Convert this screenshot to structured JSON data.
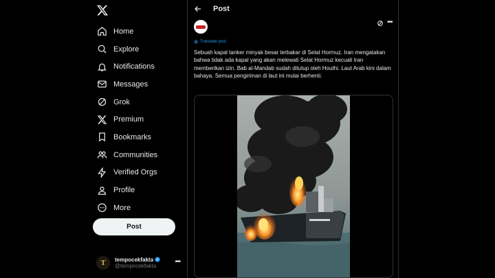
{
  "sidebar": {
    "logo_icon": "x-logo-icon",
    "items": [
      {
        "label": "Home",
        "icon": "home-icon"
      },
      {
        "label": "Explore",
        "icon": "search-icon"
      },
      {
        "label": "Notifications",
        "icon": "bell-icon"
      },
      {
        "label": "Messages",
        "icon": "mail-icon"
      },
      {
        "label": "Grok",
        "icon": "grok-icon"
      },
      {
        "label": "Premium",
        "icon": "x-premium-icon"
      },
      {
        "label": "Bookmarks",
        "icon": "bookmark-icon"
      },
      {
        "label": "Communities",
        "icon": "people-icon"
      },
      {
        "label": "Verified Orgs",
        "icon": "lightning-icon"
      },
      {
        "label": "Profile",
        "icon": "person-icon"
      },
      {
        "label": "More",
        "icon": "more-circle-icon"
      }
    ],
    "post_button_label": "Post"
  },
  "account": {
    "name": "tempocekfakta",
    "handle": "@tempocekfakta",
    "avatar_letter": "T",
    "verified": true
  },
  "main": {
    "header_title": "Post",
    "translate_label": "Translate post",
    "post_text": "Sebuah kapal tanker minyak besar terbakar di Selat Hormuz. Iran mengatakan bahwa tidak ada kapal yang akan melewati Selat Hormuz kecuali Iran memberikan izin. Bab al-Mandab sudah ditutup oleh Houthi. Laut Arab kini dalam bahaya. Semua pengiriman di laut ini mulai berhenti."
  },
  "colors": {
    "background": "#000000",
    "text": "#e7e9ea",
    "muted": "#71767b",
    "accent": "#1d9bf0",
    "border": "#2f3336",
    "button_bg": "#eff3f4"
  }
}
